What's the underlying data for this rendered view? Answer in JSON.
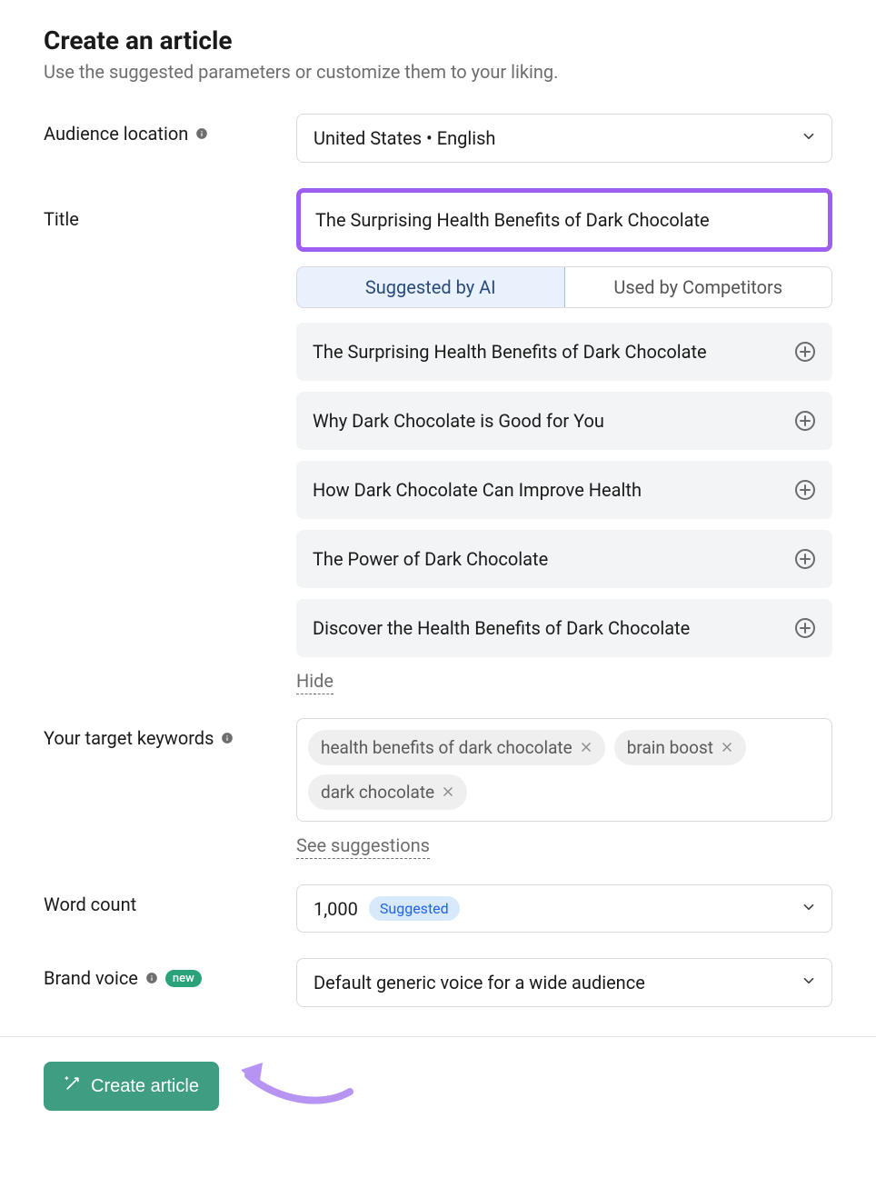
{
  "header": {
    "title": "Create an article",
    "subtitle": "Use the suggested parameters or customize them to your liking."
  },
  "audience": {
    "label": "Audience location",
    "value": "United States • English"
  },
  "titleField": {
    "label": "Title",
    "value": "The Surprising Health Benefits of Dark Chocolate",
    "tabs": {
      "ai": "Suggested by AI",
      "competitors": "Used by Competitors"
    },
    "suggestions": [
      "The Surprising Health Benefits of Dark Chocolate",
      "Why Dark Chocolate is Good for You",
      "How Dark Chocolate Can Improve Health",
      "The Power of Dark Chocolate",
      "Discover the Health Benefits of Dark Chocolate"
    ],
    "hide_label": "Hide"
  },
  "keywords": {
    "label": "Your target keywords",
    "items": [
      "health benefits of dark chocolate",
      "brain boost",
      "dark chocolate"
    ],
    "see_suggestions": "See suggestions"
  },
  "wordcount": {
    "label": "Word count",
    "value": "1,000",
    "tag": "Suggested"
  },
  "brandvoice": {
    "label": "Brand voice",
    "badge": "new",
    "value": "Default generic voice for a wide audience"
  },
  "footer": {
    "button": "Create article"
  }
}
